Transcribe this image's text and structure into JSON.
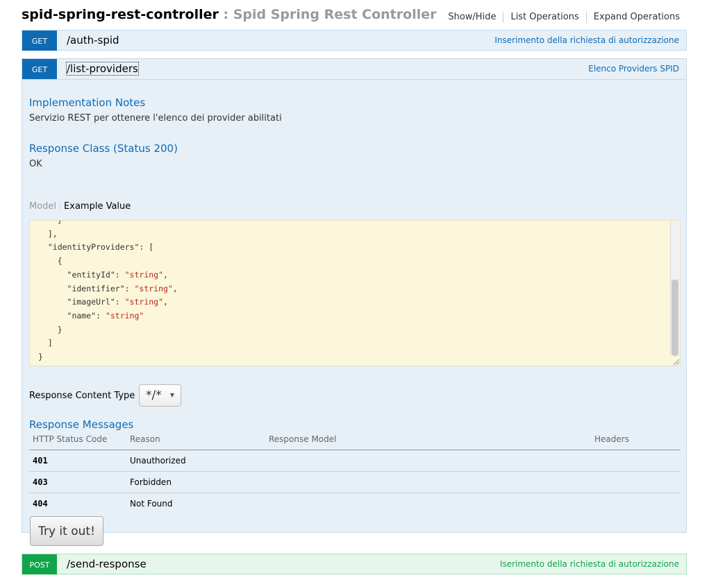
{
  "header": {
    "name": "spid-spring-rest-controller",
    "description": " : Spid Spring Rest Controller",
    "links": [
      "Show/Hide",
      "List Operations",
      "Expand Operations"
    ]
  },
  "operations": [
    {
      "method": "GET",
      "path": "/auth-spid",
      "summary": "Inserimento della richiesta di autorizzazione"
    },
    {
      "method": "GET",
      "path": "/list-providers",
      "summary": "Elenco Providers SPID"
    },
    {
      "method": "POST",
      "path": "/send-response",
      "summary": "Iserimento della richiesta di autorizzazione"
    }
  ],
  "details": {
    "impl_title": "Implementation Notes",
    "impl_text": "Servizio REST per ottenere l'elenco dei provider abilitati",
    "response_class_title": "Response Class (Status 200)",
    "response_class_value": "OK",
    "tab_model": "Model",
    "tab_example": "Example Value",
    "example_lines": [
      {
        "pre": "    }",
        "str": "",
        "post": ""
      },
      {
        "pre": "  ],",
        "str": "",
        "post": ""
      },
      {
        "pre": "  \"identityProviders\": [",
        "str": "",
        "post": ""
      },
      {
        "pre": "    {",
        "str": "",
        "post": ""
      },
      {
        "pre": "      \"entityId\": ",
        "str": "\"string\"",
        "post": ","
      },
      {
        "pre": "      \"identifier\": ",
        "str": "\"string\"",
        "post": ","
      },
      {
        "pre": "      \"imageUrl\": ",
        "str": "\"string\"",
        "post": ","
      },
      {
        "pre": "      \"name\": ",
        "str": "\"string\"",
        "post": ""
      },
      {
        "pre": "    }",
        "str": "",
        "post": ""
      },
      {
        "pre": "  ]",
        "str": "",
        "post": ""
      },
      {
        "pre": "}",
        "str": "",
        "post": ""
      }
    ],
    "content_type_label": "Response Content Type",
    "content_type_value": "*/*",
    "messages_title": "Response Messages",
    "messages_headers": [
      "HTTP Status Code",
      "Reason",
      "Response Model",
      "Headers"
    ],
    "messages": [
      {
        "code": "401",
        "reason": "Unauthorized"
      },
      {
        "code": "403",
        "reason": "Forbidden"
      },
      {
        "code": "404",
        "reason": "Not Found"
      }
    ],
    "try_label": "Try it out!"
  },
  "colors": {
    "get": "#0f6ab4",
    "post": "#10a54a",
    "code_bg": "#fcf6db",
    "string": "#b3291c"
  }
}
